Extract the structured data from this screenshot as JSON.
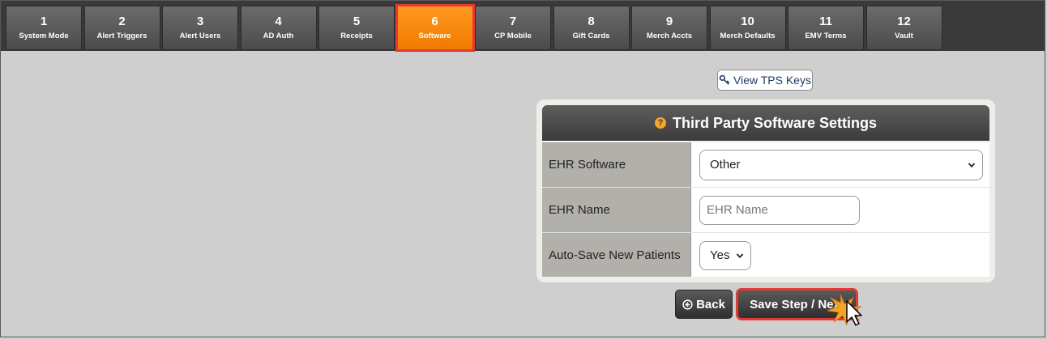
{
  "steps": [
    {
      "num": "1",
      "label": "System Mode"
    },
    {
      "num": "2",
      "label": "Alert Triggers"
    },
    {
      "num": "3",
      "label": "Alert Users"
    },
    {
      "num": "4",
      "label": "AD Auth"
    },
    {
      "num": "5",
      "label": "Receipts"
    },
    {
      "num": "6",
      "label": "Software",
      "active": true
    },
    {
      "num": "7",
      "label": "CP Mobile"
    },
    {
      "num": "8",
      "label": "Gift Cards"
    },
    {
      "num": "9",
      "label": "Merch Accts"
    },
    {
      "num": "10",
      "label": "Merch Defaults"
    },
    {
      "num": "11",
      "label": "EMV Terms"
    },
    {
      "num": "12",
      "label": "Vault"
    }
  ],
  "tps_button": {
    "label": "View TPS Keys",
    "icon": "key-icon"
  },
  "panel": {
    "title": "Third Party Software Settings",
    "help_icon": "?",
    "rows": {
      "ehr_software": {
        "label": "EHR Software",
        "value": "Other"
      },
      "ehr_name": {
        "label": "EHR Name",
        "value": "",
        "placeholder": "EHR Name"
      },
      "auto_save": {
        "label": "Auto-Save New Patients",
        "value": "Yes"
      }
    }
  },
  "buttons": {
    "back": "Back",
    "save": "Save Step / Next"
  },
  "colors": {
    "active_tab": "#f5870f",
    "highlight": "#e53935",
    "help_icon": "#f5a623"
  }
}
